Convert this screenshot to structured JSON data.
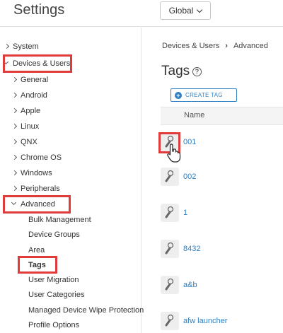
{
  "header": {
    "title": "Settings",
    "scope": "Global"
  },
  "sidebar": {
    "items": [
      {
        "label": "System",
        "state": "collapsed"
      },
      {
        "label": "Devices & Users",
        "state": "expanded",
        "highlighted": true
      },
      {
        "label": "General",
        "state": "collapsed"
      },
      {
        "label": "Android",
        "state": "collapsed"
      },
      {
        "label": "Apple",
        "state": "collapsed"
      },
      {
        "label": "Linux",
        "state": "collapsed"
      },
      {
        "label": "QNX",
        "state": "collapsed"
      },
      {
        "label": "Chrome OS",
        "state": "collapsed"
      },
      {
        "label": "Windows",
        "state": "collapsed"
      },
      {
        "label": "Peripherals",
        "state": "collapsed"
      },
      {
        "label": "Advanced",
        "state": "expanded",
        "highlighted": true
      },
      {
        "label": "Bulk Management"
      },
      {
        "label": "Device Groups"
      },
      {
        "label": "Area"
      },
      {
        "label": "Tags",
        "selected": true,
        "highlighted": true
      },
      {
        "label": "User Migration"
      },
      {
        "label": "User Categories"
      },
      {
        "label": "Managed Device Wipe Protection"
      },
      {
        "label": "Profile Options"
      }
    ]
  },
  "main": {
    "breadcrumb": [
      "Devices & Users",
      "Advanced"
    ],
    "title": "Tags",
    "create_button": "CREATE TAG",
    "column_header": "Name",
    "tags": [
      "001",
      "002",
      "1",
      "8432",
      "a&b",
      "afw launcher"
    ]
  },
  "colors": {
    "accent": "#2f7fc1",
    "highlight": "#e03b3b"
  }
}
